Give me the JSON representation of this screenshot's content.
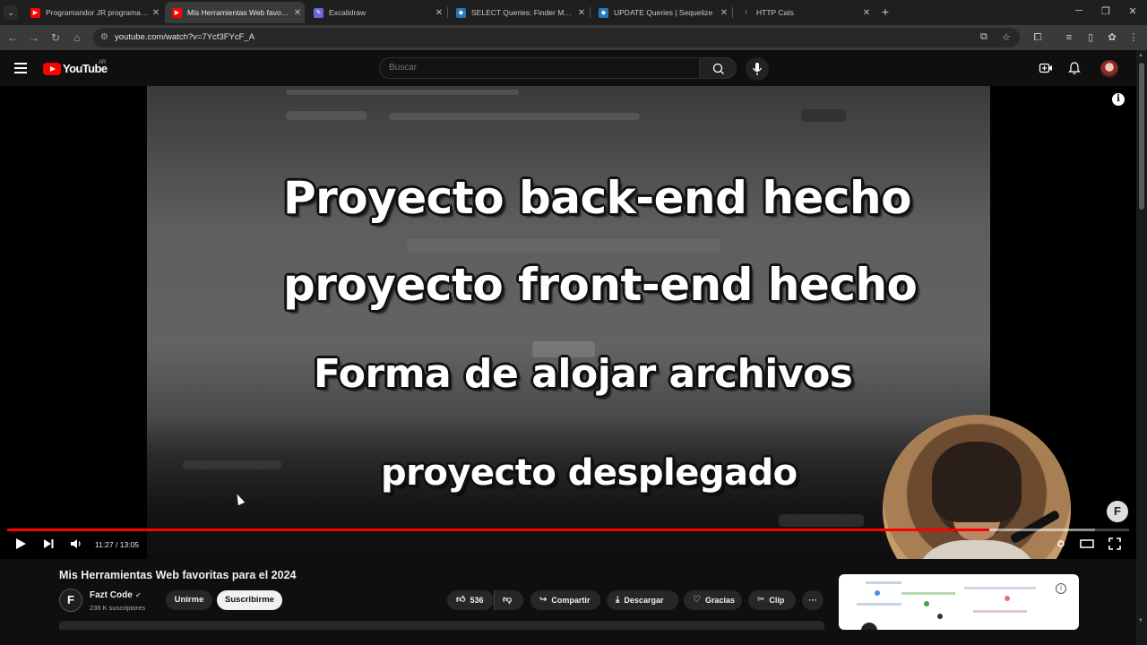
{
  "browser": {
    "tabs": [
      {
        "label": "Programandor JR programando",
        "favicon": "youtube-icon",
        "active": false
      },
      {
        "label": "Mis Herramientas Web favoritas",
        "favicon": "youtube-icon",
        "active": true
      },
      {
        "label": "Excalidraw",
        "favicon": "excalidraw-icon",
        "active": false
      },
      {
        "label": "SELECT Queries: Finder Method",
        "favicon": "sequelize-icon",
        "active": false
      },
      {
        "label": "UPDATE Queries | Sequelize",
        "favicon": "sequelize-icon",
        "active": false
      },
      {
        "label": "HTTP Cats",
        "favicon": "http-cats-icon",
        "active": false
      }
    ],
    "url": "youtube.com/watch?v=7Ycf3FYcF_A"
  },
  "header": {
    "logo_text": "YouTube",
    "country_code": "AR",
    "search_placeholder": "Buscar"
  },
  "player": {
    "captions": [
      "Proyecto back-end hecho",
      "proyecto front-end hecho",
      "Forma de alojar archivos",
      "proyecto desplegado"
    ],
    "current_time": "11:27",
    "duration": "13:05",
    "time_display": "11:27 / 13:05",
    "progress_played_fraction": 0.875,
    "progress_loaded_fraction": 0.97,
    "channel_watermark": "F"
  },
  "video": {
    "title": "Mis Herramientas Web favoritas para el 2024",
    "channel_name": "Fazt Code",
    "channel_initial": "F",
    "subscribers": "236 K suscriptores",
    "join_label": "Unirme",
    "subscribe_label": "Suscribirme",
    "like_count": "536",
    "share_label": "Compartir",
    "download_label": "Descargar",
    "thanks_label": "Gracias",
    "clip_label": "Clip",
    "more_label": "···"
  },
  "colors": {
    "accent": "#ff0000",
    "background": "#0f0f0f",
    "button_dark": "#272727",
    "button_light": "#f1f1f1"
  }
}
